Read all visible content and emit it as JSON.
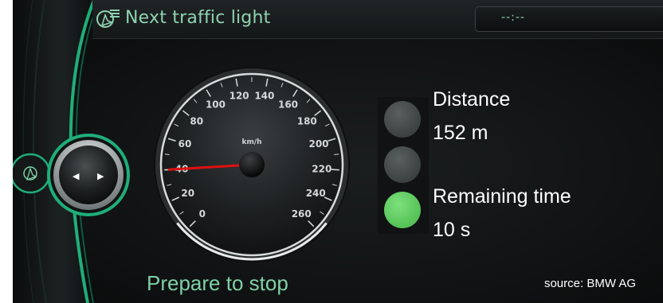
{
  "header": {
    "title": "Next traffic light",
    "title_icon": "traffic-light-navigation-icon",
    "clock_value": "--:--"
  },
  "controller": {
    "icon": "navigation-arrow-icon",
    "left_arrow": "◀",
    "right_arrow": "▶"
  },
  "speedometer": {
    "unit": "km/h",
    "tick_labels": [
      "0",
      "20",
      "40",
      "60",
      "80",
      "100",
      "120",
      "140",
      "160",
      "180",
      "200",
      "220",
      "240",
      "260"
    ],
    "range": [
      0,
      260
    ],
    "needle_value": 40,
    "colors": {
      "needle": "#e01010",
      "face": "#1a1c1d",
      "ring": "#cfd3d4"
    }
  },
  "traffic_light": {
    "active_lamp": "bottom",
    "colors": {
      "inactive": "#3c4142",
      "active": "#55c257"
    }
  },
  "info": {
    "distance_label": "Distance",
    "distance_value": "152 m",
    "remaining_label": "Remaining time",
    "remaining_value": "10 s"
  },
  "status": {
    "message": "Prepare to stop"
  },
  "footer": {
    "source": "source: BMW AG"
  },
  "colors": {
    "accent": "#8fd3b0",
    "background": "#111314"
  }
}
